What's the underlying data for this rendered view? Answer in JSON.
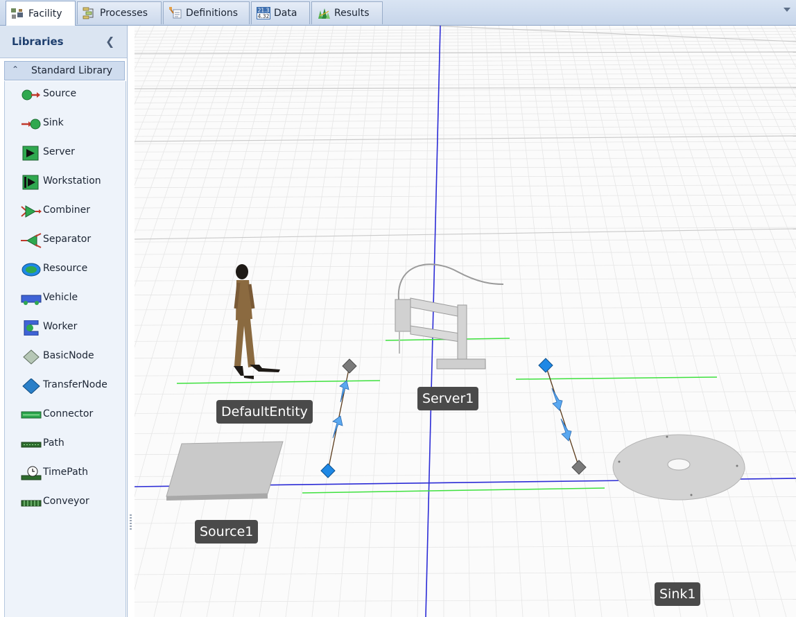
{
  "tabs": [
    {
      "label": "Facility",
      "icon": "facility-icon",
      "active": true
    },
    {
      "label": "Processes",
      "icon": "processes-icon",
      "active": false
    },
    {
      "label": "Definitions",
      "icon": "definitions-icon",
      "active": false
    },
    {
      "label": "Data",
      "icon": "data-icon",
      "active": false
    },
    {
      "label": "Results",
      "icon": "results-icon",
      "active": false
    }
  ],
  "data_icon_text": {
    "top": "21.3",
    "bottom": "4.32"
  },
  "libraries": {
    "title": "Libraries",
    "group": "Standard Library",
    "items": [
      {
        "label": "Source",
        "icon": "source-icon"
      },
      {
        "label": "Sink",
        "icon": "sink-icon"
      },
      {
        "label": "Server",
        "icon": "server-icon"
      },
      {
        "label": "Workstation",
        "icon": "workstation-icon"
      },
      {
        "label": "Combiner",
        "icon": "combiner-icon"
      },
      {
        "label": "Separator",
        "icon": "separator-icon"
      },
      {
        "label": "Resource",
        "icon": "resource-icon"
      },
      {
        "label": "Vehicle",
        "icon": "vehicle-icon"
      },
      {
        "label": "Worker",
        "icon": "worker-icon"
      },
      {
        "label": "BasicNode",
        "icon": "basic-node-icon"
      },
      {
        "label": "TransferNode",
        "icon": "transfer-node-icon"
      },
      {
        "label": "Connector",
        "icon": "connector-icon"
      },
      {
        "label": "Path",
        "icon": "path-icon"
      },
      {
        "label": "TimePath",
        "icon": "time-path-icon"
      },
      {
        "label": "Conveyor",
        "icon": "conveyor-icon"
      }
    ]
  },
  "model": {
    "default_entity": "DefaultEntity",
    "source": "Source1",
    "server": "Server1",
    "sink": "Sink1"
  },
  "colors": {
    "node_blue": "#1e88e5",
    "node_gray": "#7a7a7a",
    "axis_blue": "#2b2bd6",
    "green_line": "#3de13d",
    "label_bg": "#4a4a4a"
  }
}
